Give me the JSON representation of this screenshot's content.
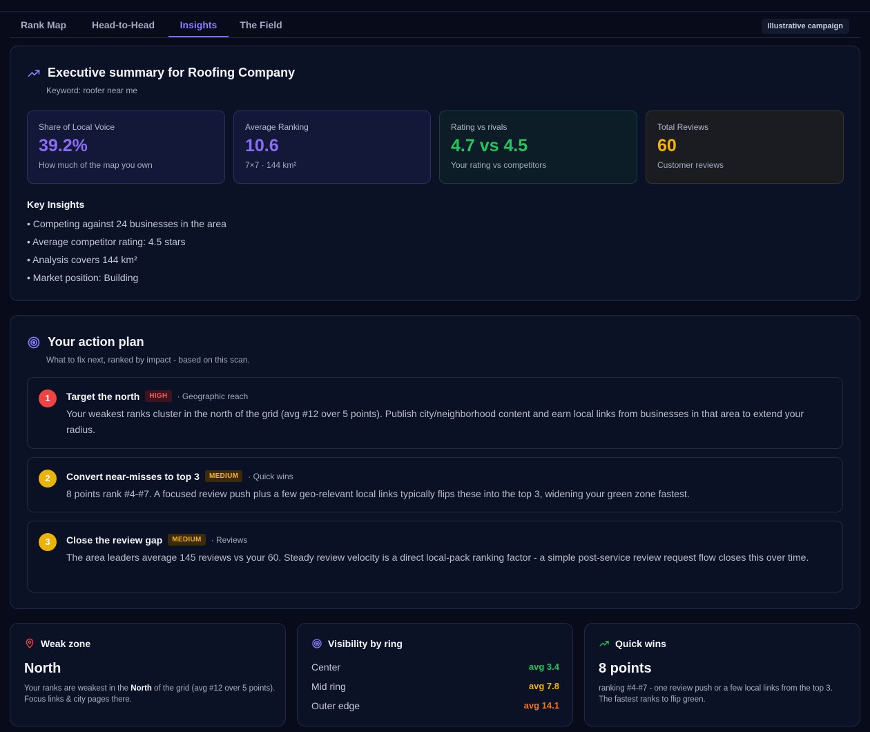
{
  "tabs": [
    {
      "label": "Rank Map"
    },
    {
      "label": "Head-to-Head"
    },
    {
      "label": "Insights"
    },
    {
      "label": "The Field"
    }
  ],
  "active_tab": "Insights",
  "campaign_badge": "Illustrative campaign",
  "summary": {
    "title": "Executive summary for Roofing Company",
    "keyword": "Keyword: roofer near me",
    "stats": [
      {
        "label": "Share of Local Voice",
        "value": "39.2%",
        "desc": "How much of the map you own",
        "color": "#8b6cf6"
      },
      {
        "label": "Average Ranking",
        "value": "10.6",
        "desc": "7×7 · 144 km²",
        "color": "#8b6cf6"
      },
      {
        "label": "Rating vs rivals",
        "value": "4.7 vs 4.5",
        "desc": "Your rating vs competitors",
        "color": "#22c55e"
      },
      {
        "label": "Total Reviews",
        "value": "60",
        "desc": "Customer reviews",
        "color": "#f5b400"
      }
    ],
    "insights_heading": "Key Insights",
    "insights": [
      "• Competing against 24 businesses in the area",
      "• Average competitor rating: 4.5 stars",
      "• Analysis covers 144 km²",
      "• Market position: Building"
    ]
  },
  "action_plan": {
    "title": "Your action plan",
    "subtitle": "What to fix next, ranked by impact - based on this scan.",
    "items": [
      {
        "num": "1",
        "title": "Target the north",
        "priority": "HIGH",
        "category": "· Geographic reach",
        "body": "Your weakest ranks cluster in the north of the grid (avg #12 over 5 points). Publish city/neighborhood content and earn local links from businesses in that area to extend your radius."
      },
      {
        "num": "2",
        "title": "Convert near-misses to top 3",
        "priority": "MEDIUM",
        "category": "· Quick wins",
        "body": "8 points rank #4-#7. A focused review push plus a few geo-relevant local links typically flips these into the top 3, widening your green zone fastest."
      },
      {
        "num": "3",
        "title": "Close the review gap",
        "priority": "MEDIUM",
        "category": "· Reviews",
        "body": "The area leaders average 145 reviews vs your 60. Steady review velocity is a direct local-pack ranking factor - a simple post-service review request flow closes this over time."
      }
    ]
  },
  "weak_zone": {
    "title": "Weak zone",
    "value": "North",
    "text_before": "Your ranks are weakest in the ",
    "text_bold": "North",
    "text_after": " of the grid (avg #12 over 5 points). Focus links & city pages there."
  },
  "visibility": {
    "title": "Visibility by ring",
    "rings": [
      {
        "label": "Center",
        "value": "avg 3.4",
        "color": "#22c55e"
      },
      {
        "label": "Mid ring",
        "value": "avg 7.8",
        "color": "#f5b400"
      },
      {
        "label": "Outer edge",
        "value": "avg 14.1",
        "color": "#f97316"
      }
    ]
  },
  "quick_wins": {
    "title": "Quick wins",
    "value": "8 points",
    "text": "ranking #4-#7 - one review push or a few local links from the top 3. The fastest ranks to flip green."
  },
  "colors": {
    "accent": "#7c6cf5",
    "high": "#ef4444",
    "medium": "#eab308",
    "green": "#22c55e"
  }
}
